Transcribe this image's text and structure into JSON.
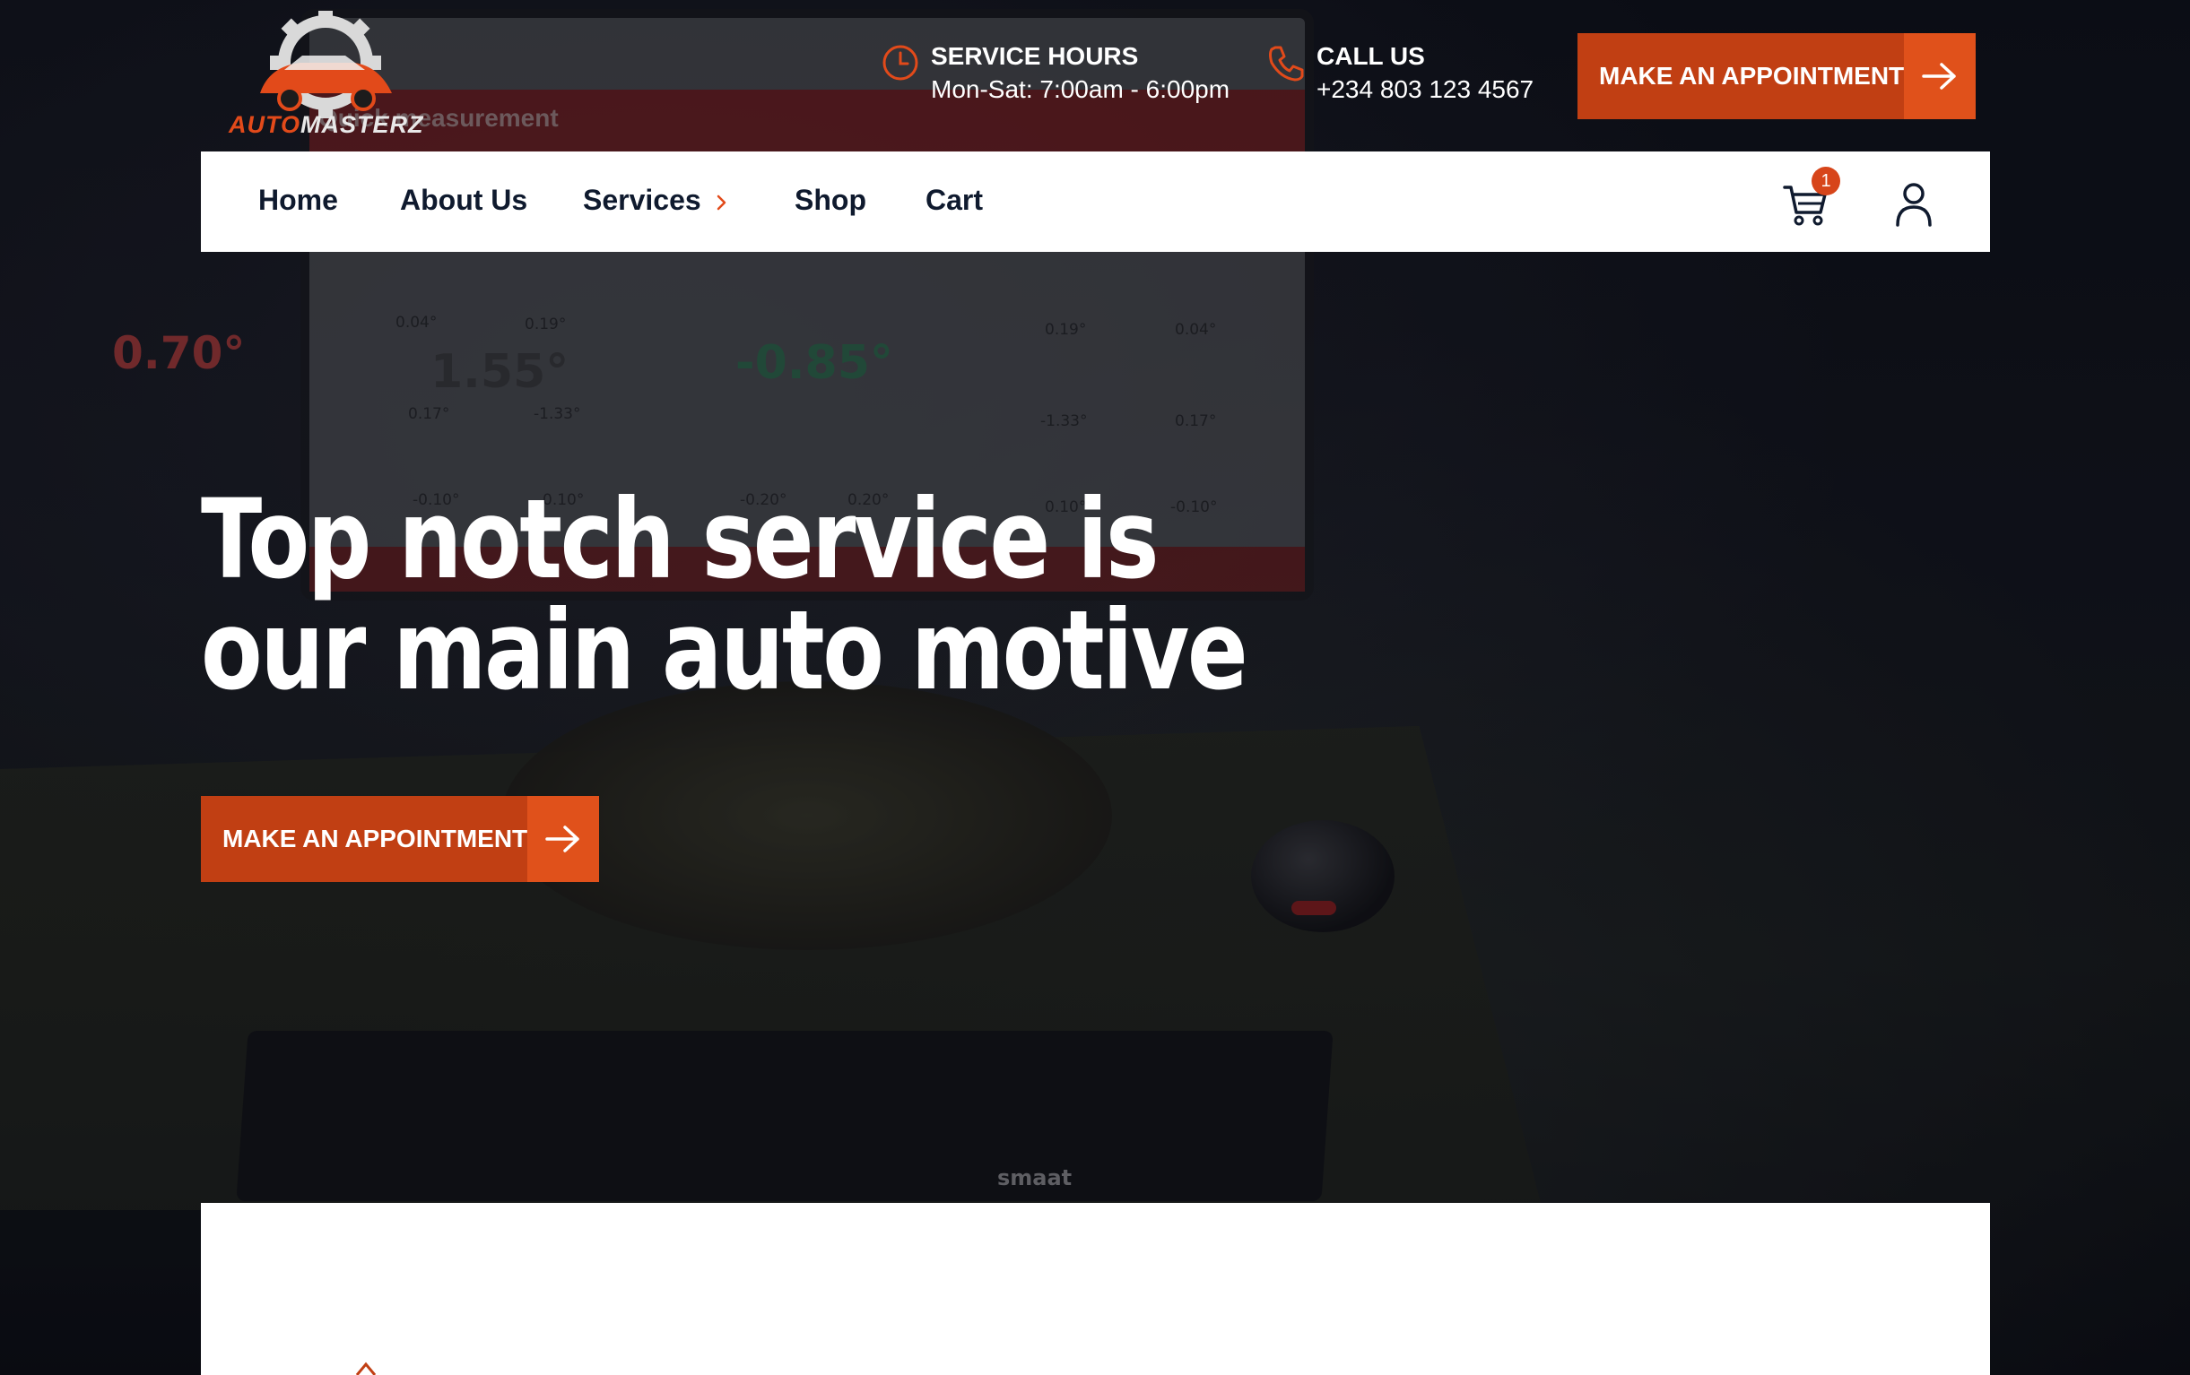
{
  "brand": {
    "logo_prefix": "AUTO",
    "logo_suffix": "MASTERZ",
    "accent_color": "#e24a1a",
    "button_color": "#c13f13",
    "button_arrow_color": "#e0511b"
  },
  "background": {
    "monitor_banner": "Quick measurement",
    "readings": [
      "0.70°",
      "1.55°",
      "-0.85°"
    ],
    "small_values": [
      "0.04°",
      "0.19°",
      "0.17°",
      "-1.33°",
      "-0.10°",
      "0.10°",
      "-0.20°",
      "0.20°",
      "0.19°",
      "0.04°",
      "-1.33°",
      "0.17°",
      "0.10°",
      "-0.10°"
    ],
    "keyboard_brand": "smaat"
  },
  "header": {
    "service_hours": {
      "icon": "clock-icon",
      "title": "SERVICE HOURS",
      "value": "Mon-Sat: 7:00am - 6:00pm"
    },
    "call_us": {
      "icon": "phone-icon",
      "title": "CALL US",
      "value": "+234 803 123 4567"
    },
    "appointment_button": {
      "label": "MAKE AN APPOINTMENT",
      "icon": "arrow-right-icon"
    }
  },
  "nav": {
    "items": [
      {
        "label": "Home"
      },
      {
        "label": "About Us"
      },
      {
        "label": "Services",
        "icon": "chevron-right-icon"
      },
      {
        "label": "Shop"
      },
      {
        "label": "Cart"
      }
    ],
    "cart_count": "1",
    "cart_icon": "cart-icon",
    "user_icon": "user-icon"
  },
  "hero": {
    "title_line1": "Top notch service is",
    "title_line2": "our main auto motive",
    "cta_label": "MAKE AN APPOINTMENT",
    "cta_icon": "arrow-right-icon"
  }
}
